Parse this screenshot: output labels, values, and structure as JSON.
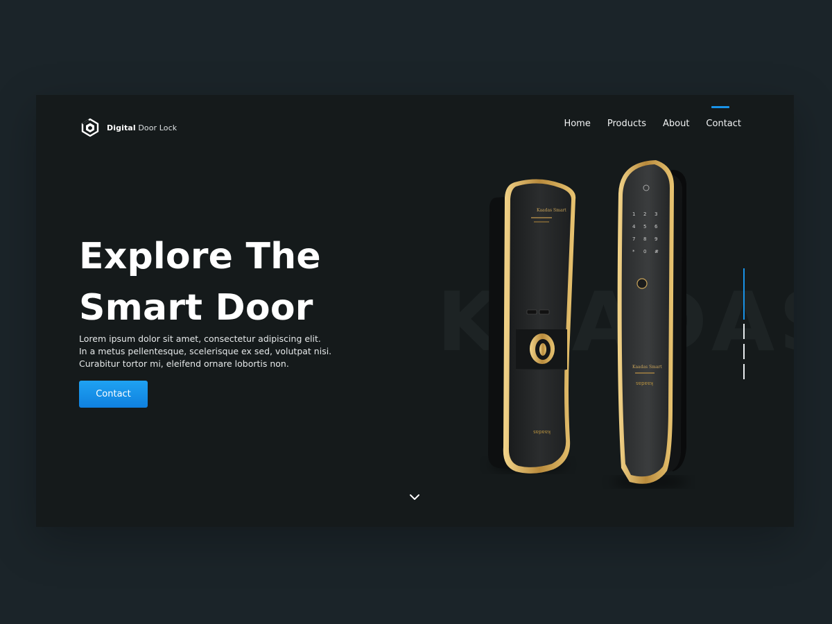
{
  "brand": {
    "name_bold": "Digital",
    "name_light": "Door Lock",
    "icon": "digital-door-lock-logo-icon"
  },
  "nav": {
    "items": [
      {
        "label": "Home",
        "active": false
      },
      {
        "label": "Products",
        "active": false
      },
      {
        "label": "About",
        "active": false
      },
      {
        "label": "Contact",
        "active": true
      }
    ]
  },
  "hero": {
    "title_line1": "Explore The",
    "title_line2": "Smart Door",
    "desc_line1": "Lorem ipsum dolor sit amet, consectetur adipiscing elit.",
    "desc_line2": "In a metus pellentesque, scelerisque ex sed, volutpat nisi.",
    "desc_line3": "Curabitur tortor mi, eleifend ornare lobortis non.",
    "cta_label": "Contact"
  },
  "watermark": "KAADAS",
  "slider": {
    "count": 4,
    "active_index": 0
  },
  "colors": {
    "accent": "#1993e8",
    "page_background": "#1b2429",
    "panel_background": "#151a1b",
    "gold": "#c9a45a"
  },
  "icons": {
    "scroll_down": "chevron-down-icon"
  }
}
